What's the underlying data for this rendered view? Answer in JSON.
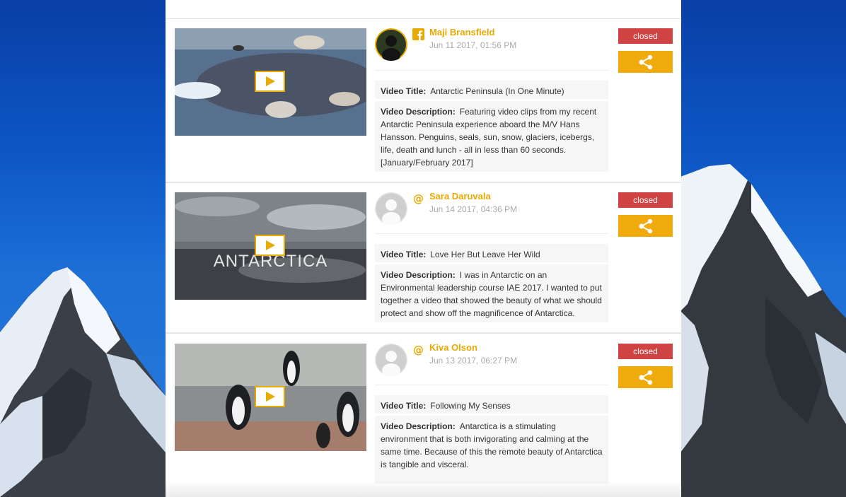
{
  "colors": {
    "accent": "#e8a900",
    "status_closed": "#d04343",
    "share_bg": "#efaa0c"
  },
  "posts": [
    {
      "source_icon": "facebook-icon",
      "avatar": "photo-avatar",
      "username": "Maji Bransfield",
      "date": "Jun 11 2017, 01:56 PM",
      "title_label": "Video Title:",
      "title": "Antarctic Peninsula (In One Minute)",
      "desc_label": "Video Description:",
      "description": "Featuring video clips from my recent Antarctic Peninsula experience aboard the M/V Hans Hansson. Penguins, seals, sun, snow, glaciers, icebergs, life, death and lunch - all in less than 60 seconds. [January/February 2017]",
      "status": "closed",
      "thumbnail_overlay": ""
    },
    {
      "source_icon": "at-sign-icon",
      "avatar": "default-avatar",
      "username": "Sara Daruvala",
      "date": "Jun 14 2017, 04:36 PM",
      "title_label": "Video Title:",
      "title": "Love Her But Leave Her Wild",
      "desc_label": "Video Description:",
      "description": "I was in Antarctic on an Environmental leadership course IAE 2017. I wanted to put together a video that showed the beauty of what we should protect and show off the magnificence of Antarctica.",
      "status": "closed",
      "thumbnail_overlay": "ANTARCTICA"
    },
    {
      "source_icon": "at-sign-icon",
      "avatar": "default-avatar",
      "username": "Kiva Olson",
      "date": "Jun 13 2017, 06:27 PM",
      "title_label": "Video Title:",
      "title": "Following My Senses",
      "desc_label": "Video Description:",
      "description": "Antarctica is a stimulating environment that is both invigorating and calming at the same time. Because of this the remote beauty of Antarctica is tangible and visceral.",
      "status": "closed",
      "thumbnail_overlay": ""
    }
  ]
}
